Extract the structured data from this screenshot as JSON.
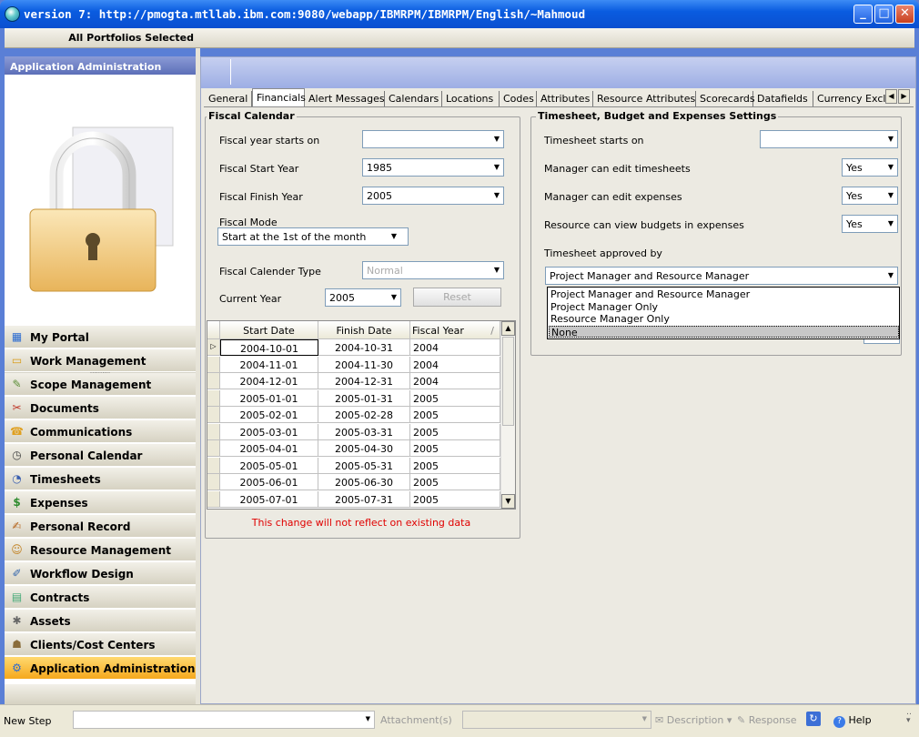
{
  "window": {
    "title": "version 7: http://pmogta.mtllab.ibm.com:9080/webapp/IBMRPM/IBMRPM/English/~Mahmoud"
  },
  "portfolio_bar": {
    "label": "All Portfolios Selected"
  },
  "left_panel": {
    "header": "Application Administration",
    "nav_items": [
      {
        "label": "My Portal",
        "icon": "portal-icon"
      },
      {
        "label": "Work Management",
        "icon": "folder-icon"
      },
      {
        "label": "Scope Management",
        "icon": "scope-icon"
      },
      {
        "label": "Documents",
        "icon": "documents-icon"
      },
      {
        "label": "Communications",
        "icon": "communications-icon"
      },
      {
        "label": "Personal Calendar",
        "icon": "calendar-icon"
      },
      {
        "label": "Timesheets",
        "icon": "clock-icon"
      },
      {
        "label": "Expenses",
        "icon": "money-icon"
      },
      {
        "label": "Personal Record",
        "icon": "personal-record-icon"
      },
      {
        "label": "Resource Management",
        "icon": "people-icon"
      },
      {
        "label": "Workflow Design",
        "icon": "workflow-icon"
      },
      {
        "label": "Contracts",
        "icon": "contracts-icon"
      },
      {
        "label": "Assets",
        "icon": "assets-icon"
      },
      {
        "label": "Clients/Cost Centers",
        "icon": "clients-icon"
      },
      {
        "label": "Application Administration",
        "icon": "admin-icon",
        "active": true
      }
    ]
  },
  "tabs": [
    {
      "label": "General"
    },
    {
      "label": "Financials",
      "active": true
    },
    {
      "label": "Alert Messages"
    },
    {
      "label": "Calendars"
    },
    {
      "label": "Locations"
    },
    {
      "label": "Codes"
    },
    {
      "label": "Attributes"
    },
    {
      "label": "Resource Attributes"
    },
    {
      "label": "Scorecards"
    },
    {
      "label": "Datafields"
    },
    {
      "label": "Currency Excl"
    }
  ],
  "fiscal": {
    "title": "Fiscal Calendar",
    "year_starts_label": "Fiscal year starts on",
    "year_starts_value": "",
    "start_year_label": "Fiscal Start Year",
    "start_year_value": "1985",
    "finish_year_label": "Fiscal Finish Year",
    "finish_year_value": "2005",
    "mode_label": "Fiscal Mode",
    "mode_value": "Start at the 1st of the month",
    "calendar_type_label": "Fiscal Calender Type",
    "calendar_type_value": "Normal",
    "current_year_label": "Current Year",
    "current_year_value": "2005",
    "reset_label": "Reset",
    "grid_headers": [
      "Start Date",
      "Finish Date",
      "Fiscal Year"
    ],
    "grid_rows": [
      [
        "2004-10-01",
        "2004-10-31",
        "2004"
      ],
      [
        "2004-11-01",
        "2004-11-30",
        "2004"
      ],
      [
        "2004-12-01",
        "2004-12-31",
        "2004"
      ],
      [
        "2005-01-01",
        "2005-01-31",
        "2005"
      ],
      [
        "2005-02-01",
        "2005-02-28",
        "2005"
      ],
      [
        "2005-03-01",
        "2005-03-31",
        "2005"
      ],
      [
        "2005-04-01",
        "2005-04-30",
        "2005"
      ],
      [
        "2005-05-01",
        "2005-05-31",
        "2005"
      ],
      [
        "2005-06-01",
        "2005-06-30",
        "2005"
      ],
      [
        "2005-07-01",
        "2005-07-31",
        "2005"
      ]
    ],
    "warning": "This change will not reflect on existing data",
    "warning_color": "#e00000"
  },
  "timesheet": {
    "title": "Timesheet, Budget and Expenses Settings",
    "starts_label": "Timesheet starts on",
    "starts_value": "",
    "mgr_timesheets_label": "Manager can edit timesheets",
    "mgr_timesheets_value": "Yes",
    "mgr_expenses_label": "Manager can edit expenses",
    "mgr_expenses_value": "Yes",
    "res_budgets_label": "Resource can view budgets in expenses",
    "res_budgets_value": "Yes",
    "approved_by_label": "Timesheet approved by",
    "approved_by_value": "Project Manager and Resource Manager",
    "approved_by_options": [
      "Project Manager and Resource Manager",
      "Project Manager Only",
      "Resource Manager Only",
      "None"
    ]
  },
  "status_bar": {
    "new_step_label": "New Step",
    "attachments_label": "Attachment(s)",
    "description_label": "Description",
    "response_label": "Response",
    "help_label": "Help"
  }
}
